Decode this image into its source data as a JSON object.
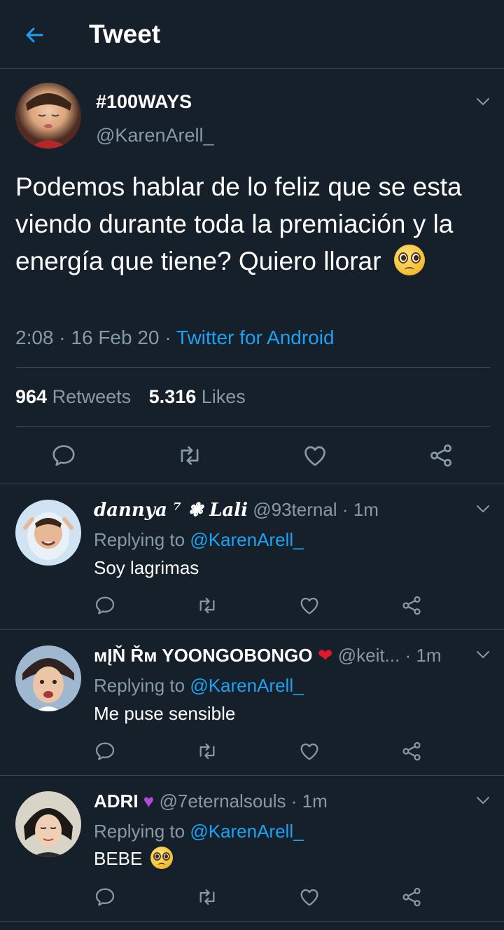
{
  "header": {
    "title": "Tweet"
  },
  "tweet": {
    "name": "#100WAYS",
    "handle": "@KarenArell_",
    "text": "Podemos hablar de lo feliz que se esta viendo durante toda la premiación y la energía que tiene? Quiero llorar",
    "emoji": "pleading-face",
    "time": "2:08",
    "date": "16 Feb 20",
    "source": "Twitter for Android",
    "retweets_count": "964",
    "retweets_label": "Retweets",
    "likes_count": "5.316",
    "likes_label": "Likes"
  },
  "replies": [
    {
      "name": "dannya ⁷ ❃ Lali",
      "handle": "@93ternal",
      "time": "1m",
      "replying_prefix": "Replying to",
      "replying_to": "@KarenArell_",
      "text": "Soy lagrimas"
    },
    {
      "name": "ᴍĮŇ Řᴍ YOONGOBONGO",
      "name_emoji": "red-heart",
      "handle": "@keit...",
      "time": "1m",
      "replying_prefix": "Replying to",
      "replying_to": "@KarenArell_",
      "text": "Me puse sensible"
    },
    {
      "name": "ADRI",
      "name_emoji": "purple-heart",
      "handle": "@7eternalsouls",
      "time": "1m",
      "replying_prefix": "Replying to",
      "replying_to": "@KarenArell_",
      "text": "BEBE",
      "text_emoji": "pleading-face"
    }
  ],
  "icons": {
    "back": "back-arrow-icon",
    "chevron": "chevron-down-icon",
    "reply": "reply-icon",
    "retweet": "retweet-icon",
    "like": "like-icon",
    "share": "share-icon"
  },
  "colors": {
    "background": "#15202b",
    "accent": "#1da1f2",
    "muted": "#8899a6",
    "divider": "#38444d"
  }
}
